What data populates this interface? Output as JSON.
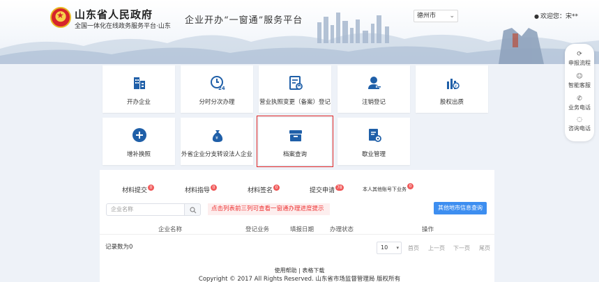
{
  "header": {
    "gov_title": "山东省人民政府",
    "gov_subtitle": "全国一体化在线政务服务平台·山东",
    "platform_title": "企业开办“一窗通”服务平台",
    "city_select": "德州市",
    "user_greeting": "欢迎您：",
    "user_name": "宋**"
  },
  "tiles": [
    {
      "label": "开办企业",
      "icon": "building-icon"
    },
    {
      "label": "分时分次办理",
      "icon": "clock-24-icon"
    },
    {
      "label": "营业执照变更（备案）登记",
      "icon": "document-refresh-icon"
    },
    {
      "label": "注销登记",
      "icon": "user-minus-icon"
    },
    {
      "label": "股权出质",
      "icon": "bar-chart-coin-icon"
    },
    {
      "label": "增补换照",
      "icon": "plus-circle-icon"
    },
    {
      "label": "外省企业分支转设法人企业",
      "icon": "money-bag-icon"
    },
    {
      "label": "档案查询",
      "icon": "archive-box-icon"
    },
    {
      "label": "歇业管理",
      "icon": "document-gear-icon"
    }
  ],
  "float_bar": [
    {
      "label": "申报流程",
      "icon": "flow-icon"
    },
    {
      "label": "智能客服",
      "icon": "chat-bot-icon"
    },
    {
      "label": "业务电话",
      "icon": "phone-icon"
    },
    {
      "label": "咨询电话",
      "icon": "headset-icon"
    }
  ],
  "tabs": [
    {
      "label": "材料提交",
      "badge": "0"
    },
    {
      "label": "材料指导",
      "badge": "0"
    },
    {
      "label": "材料签名",
      "badge": "0"
    },
    {
      "label": "提交申请",
      "badge": "78"
    },
    {
      "label": "本人其他账号下业务",
      "badge": "0"
    }
  ],
  "search": {
    "placeholder": "企业名称"
  },
  "notice": "点击列表前三列可查看一窗通办理进度提示",
  "other_city_button": "其他地市信息查询",
  "table_headers": [
    "企业名称",
    "登记业务",
    "填报日期",
    "办理状态",
    "操作"
  ],
  "records_label": "记录数为0",
  "page_size": "10",
  "pager": [
    "首页",
    "上一页",
    "下一页",
    "尾页"
  ],
  "footer_links": "使用帮助 | 表格下载",
  "copyright": "Copyright © 2017 All Rights Reserved. 山东省市场监督管理局 版权所有",
  "colors": {
    "accent": "#3d8ef0",
    "icon_blue": "#1f5fa8",
    "selected_border": "#e02424",
    "badge": "#f05a5a"
  }
}
